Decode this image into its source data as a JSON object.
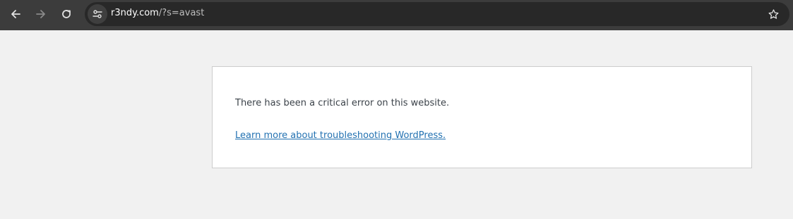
{
  "browser": {
    "url": {
      "host": "r3ndy.com",
      "path": "/?s=avast"
    },
    "icons": {
      "back": "back-arrow-icon",
      "forward": "forward-arrow-icon",
      "reload": "reload-icon",
      "site_info": "site-settings-icon",
      "bookmark": "star-icon"
    },
    "colors": {
      "toolbar": "#3c3c3c",
      "omnibox": "#282828"
    }
  },
  "page": {
    "error_message": "There has been a critical error on this website.",
    "help_link": "Learn more about troubleshooting WordPress.",
    "colors": {
      "background": "#f1f1f1",
      "link": "#2271b1",
      "text": "#3c434a"
    }
  }
}
